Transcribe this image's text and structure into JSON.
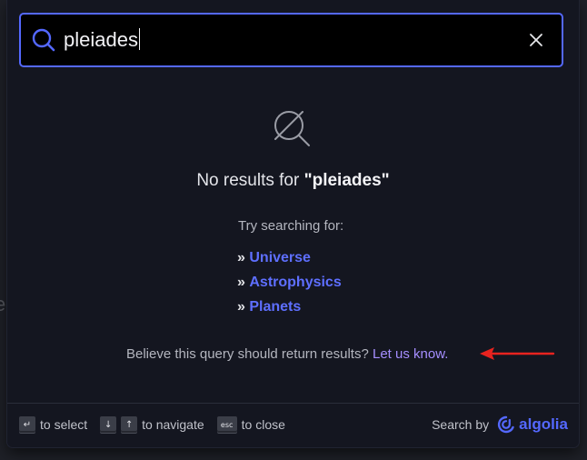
{
  "search": {
    "query": "pleiades"
  },
  "no_results": {
    "prefix": "No results for ",
    "open_quote": "\"",
    "query": "pleiades",
    "close_quote": "\""
  },
  "suggestions": {
    "label": "Try searching for:",
    "bullet": "»",
    "items": [
      {
        "label": "Universe"
      },
      {
        "label": "Astrophysics"
      },
      {
        "label": "Planets"
      }
    ]
  },
  "feedback": {
    "text": "Believe this query should return results?",
    "link": "Let us know."
  },
  "footer": {
    "commands": [
      {
        "keys": [
          "↵"
        ],
        "label": "to select"
      },
      {
        "keys": [
          "↓",
          "↑"
        ],
        "label": "to navigate"
      },
      {
        "keys": [
          "esc"
        ],
        "label": "to close"
      }
    ],
    "search_by": "Search by",
    "brand": "algolia"
  },
  "colors": {
    "accent": "#5468ff",
    "link": "#5e6fff",
    "feedback_link": "#a58eff",
    "annotation_arrow": "#e8231f",
    "background": "#141620"
  },
  "icons": {
    "search": "search-icon",
    "clear": "close-icon",
    "no_results": "search-slash-icon",
    "annotation": "red-arrow-icon",
    "brand": "algolia-logo-icon"
  },
  "background_text": "e"
}
